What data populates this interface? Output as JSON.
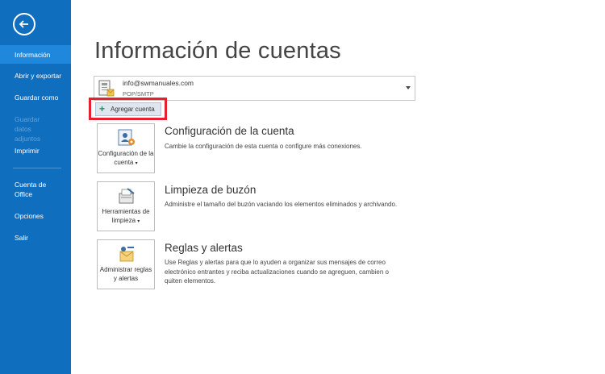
{
  "sidebar": {
    "items": [
      {
        "label": "Información"
      },
      {
        "label": "Abrir y exportar"
      },
      {
        "label": "Guardar como"
      },
      {
        "label": "Guardar datos adjuntos"
      },
      {
        "label": "Imprimir"
      },
      {
        "label": "Cuenta de Office"
      },
      {
        "label": "Opciones"
      },
      {
        "label": "Salir"
      }
    ]
  },
  "page": {
    "title": "Información de cuentas"
  },
  "account": {
    "email": "info@swmanuales.com",
    "type": "POP/SMTP"
  },
  "add_account": {
    "label": "Agregar cuenta"
  },
  "sections": [
    {
      "tile_label": "Configuración de la cuenta",
      "title": "Configuración de la cuenta",
      "description": "Cambie la configuración de esta cuenta o configure más conexiones."
    },
    {
      "tile_label": "Herramientas de limpieza",
      "title": "Limpieza de buzón",
      "description": "Administre el tamaño del buzón vaciando los elementos eliminados y archivando."
    },
    {
      "tile_label": "Administrar reglas y alertas",
      "title": "Reglas y alertas",
      "description": "Use Reglas y alertas para que lo ayuden a organizar sus mensajes de correo electrónico entrantes y reciba actualizaciones cuando se agreguen, cambien o quiten elementos."
    }
  ],
  "colors": {
    "sidebar": "#106ebe",
    "active_item": "#1f88dd",
    "highlight": "#e6202e"
  },
  "icons": [
    "back-arrow-icon",
    "account-card-icon",
    "plus-icon",
    "account-settings-icon",
    "cleanup-tools-icon",
    "rules-alerts-icon",
    "dropdown-arrow-icon"
  ]
}
